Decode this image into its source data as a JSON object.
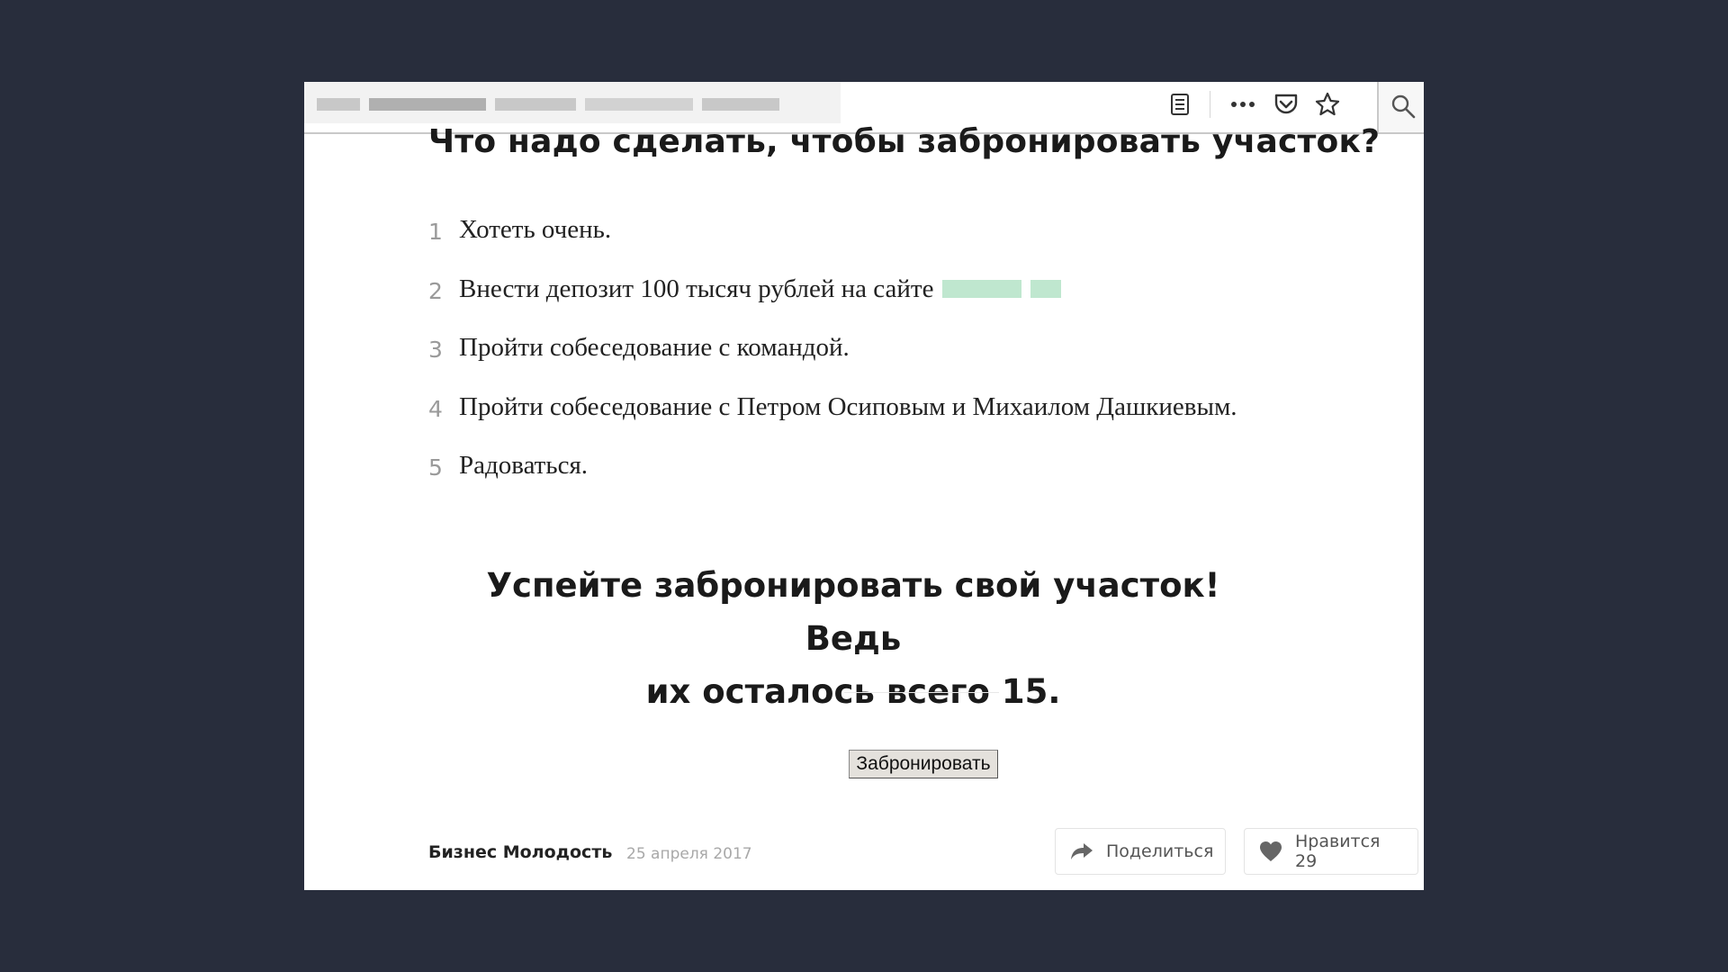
{
  "toolbar": {
    "icons": [
      "reader-view-icon",
      "more-icon",
      "pocket-icon",
      "bookmark-star-icon",
      "search-icon"
    ]
  },
  "article": {
    "heading": "Что надо сделать, чтобы забронировать участок?",
    "steps": [
      {
        "num": "1",
        "text": "Хотеть очень."
      },
      {
        "num": "2",
        "text": "Внести депозит 100 тысяч рублей на сайте"
      },
      {
        "num": "3",
        "text": "Пройти собеседование с командой."
      },
      {
        "num": "4",
        "text": "Пройти собеседование с Петром Осиповым и Михаилом Дашкиевым."
      },
      {
        "num": "5",
        "text": "Радоваться."
      }
    ],
    "cta_line1": "Успейте забронировать свой участок! Ведь",
    "cta_line2": "их осталось всего 15.",
    "book_button": "Забронировать"
  },
  "footer": {
    "author": "Бизнес Молодость",
    "date": "25 апреля 2017",
    "share_label": "Поделиться",
    "like_label": "Нравится 29"
  },
  "colors": {
    "background": "#282d3c",
    "page": "#ffffff",
    "link_highlight": "#bfe7cf"
  }
}
